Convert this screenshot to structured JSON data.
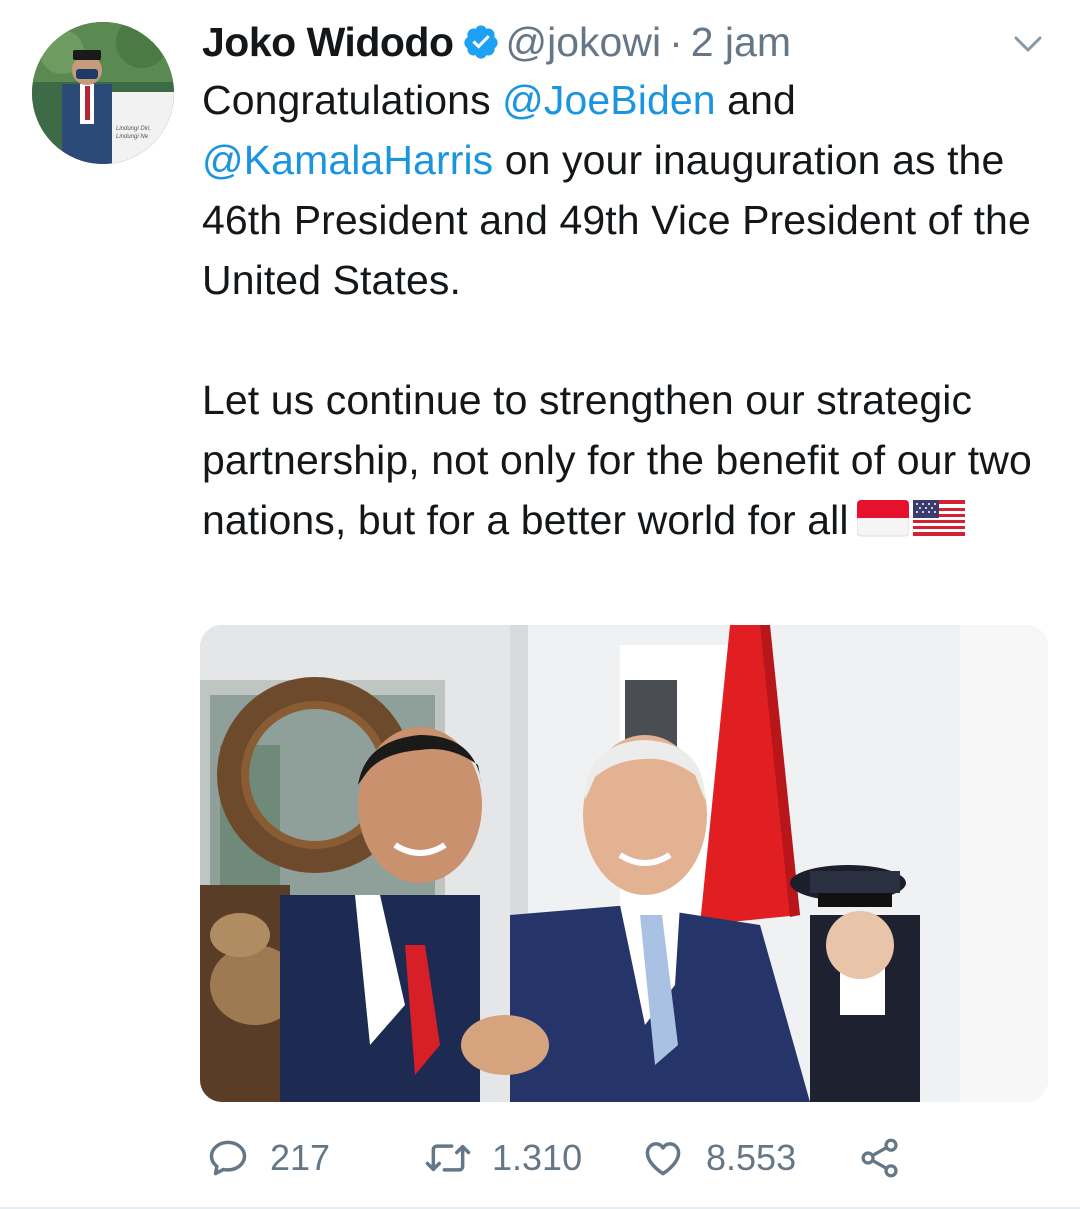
{
  "author": {
    "name": "Joko Widodo",
    "handle": "@jokowi",
    "separator": "·",
    "time": "2 jam",
    "avatar_caption": [
      "Lindungi Diri,",
      "Lindungi Ne"
    ]
  },
  "tweet": {
    "paragraph1": {
      "part1": "Congratulations ",
      "mention1": "@JoeBiden",
      "part2": " and",
      "mention2": "@KamalaHarris",
      "part3": " on your inauguration as the 46th President and 49th Vice President of the United States."
    },
    "paragraph2": "Let us continue to strengthen our strategic partnership, not only for the benefit of our two nations, but for a better world for all",
    "emoji": [
      "flag-indonesia",
      "flag-united-states"
    ]
  },
  "actions": {
    "replies": "217",
    "retweets": "1.310",
    "likes": "8.553"
  },
  "icons": {
    "verified": "verified-badge-icon",
    "menu": "chevron-down-icon",
    "reply": "reply-icon",
    "retweet": "retweet-icon",
    "like": "heart-icon",
    "share": "share-icon"
  },
  "colors": {
    "text": "#14171a",
    "secondary": "#657786",
    "link": "#1b95e0",
    "verified": "#1da1f2"
  }
}
